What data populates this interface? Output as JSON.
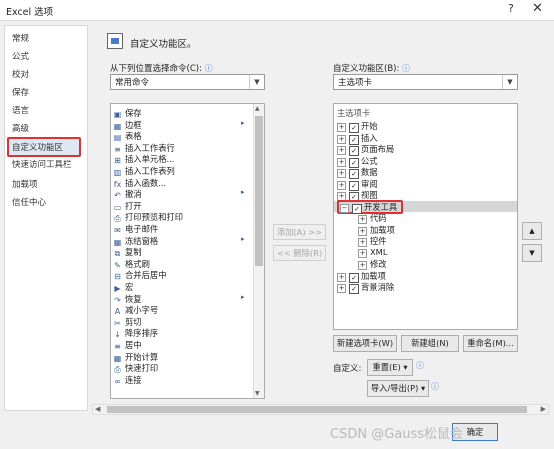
{
  "window": {
    "title": "Excel 选项",
    "help": "?",
    "close": "✕"
  },
  "nav": {
    "items": [
      "常规",
      "公式",
      "校对",
      "保存",
      "语言",
      "高级",
      "自定义功能区",
      "快速访问工具栏",
      "加载项",
      "信任中心"
    ]
  },
  "header": {
    "text": "自定义功能区。"
  },
  "left": {
    "label": "从下列位置选择命令(C):",
    "info": "ⓘ",
    "combo_value": "常用命令",
    "commands": [
      {
        "icon": "save-icon",
        "glyph": "▣",
        "label": "保存",
        "sub": ""
      },
      {
        "icon": "border-icon",
        "glyph": "▦",
        "label": "边框",
        "sub": "▸"
      },
      {
        "icon": "table-icon",
        "glyph": "▤",
        "label": "表格",
        "sub": ""
      },
      {
        "icon": "insert-row-icon",
        "glyph": "≡",
        "label": "插入工作表行",
        "sub": ""
      },
      {
        "icon": "insert-cell-icon",
        "glyph": "⊞",
        "label": "插入单元格...",
        "sub": ""
      },
      {
        "icon": "insert-col-icon",
        "glyph": "▥",
        "label": "插入工作表列",
        "sub": ""
      },
      {
        "icon": "function-icon",
        "glyph": "fx",
        "label": "插入函数...",
        "sub": ""
      },
      {
        "icon": "undo-icon",
        "glyph": "↶",
        "label": "撤消",
        "sub": "▸"
      },
      {
        "icon": "open-icon",
        "glyph": "▭",
        "label": "打开",
        "sub": ""
      },
      {
        "icon": "print-preview-icon",
        "glyph": "⎙",
        "label": "打印预览和打印",
        "sub": ""
      },
      {
        "icon": "mail-icon",
        "glyph": "✉",
        "label": "电子邮件",
        "sub": ""
      },
      {
        "icon": "freeze-icon",
        "glyph": "▦",
        "label": "冻结窗格",
        "sub": "▸"
      },
      {
        "icon": "copy-icon",
        "glyph": "⧉",
        "label": "复制",
        "sub": ""
      },
      {
        "icon": "format-painter-icon",
        "glyph": "✎",
        "label": "格式刷",
        "sub": ""
      },
      {
        "icon": "merge-center-icon",
        "glyph": "⊟",
        "label": "合并后居中",
        "sub": ""
      },
      {
        "icon": "macro-icon",
        "glyph": "▶",
        "label": "宏",
        "sub": ""
      },
      {
        "icon": "redo-icon",
        "glyph": "↷",
        "label": "恢复",
        "sub": "▸"
      },
      {
        "icon": "font-smaller-icon",
        "glyph": "A",
        "label": "减小字号",
        "sub": ""
      },
      {
        "icon": "cut-icon",
        "glyph": "✂",
        "label": "剪切",
        "sub": ""
      },
      {
        "icon": "sort-desc-icon",
        "glyph": "↓",
        "label": "降序排序",
        "sub": ""
      },
      {
        "icon": "center-icon",
        "glyph": "≡",
        "label": "居中",
        "sub": ""
      },
      {
        "icon": "calc-icon",
        "glyph": "▦",
        "label": "开始计算",
        "sub": ""
      },
      {
        "icon": "quick-print-icon",
        "glyph": "⎙",
        "label": "快速打印",
        "sub": ""
      },
      {
        "icon": "link-icon",
        "glyph": "∞",
        "label": "连接",
        "sub": ""
      }
    ]
  },
  "middle": {
    "add": "添加(A) >>",
    "remove": "<< 删除(R)"
  },
  "right": {
    "label": "自定义功能区(B):",
    "info": "ⓘ",
    "combo_value": "主选项卡",
    "tree_header": "主选项卡",
    "tree": [
      {
        "label": "开始",
        "exp": "⊞",
        "check": true,
        "level": 0
      },
      {
        "label": "插入",
        "exp": "⊞",
        "check": true,
        "level": 0
      },
      {
        "label": "页面布局",
        "exp": "⊞",
        "check": true,
        "level": 0
      },
      {
        "label": "公式",
        "exp": "⊞",
        "check": true,
        "level": 0
      },
      {
        "label": "数据",
        "exp": "⊞",
        "check": true,
        "level": 0
      },
      {
        "label": "审阅",
        "exp": "⊞",
        "check": true,
        "level": 0
      },
      {
        "label": "视图",
        "exp": "⊞",
        "check": true,
        "level": 0
      },
      {
        "label": "开发工具",
        "exp": "⊟",
        "check": true,
        "level": 0,
        "highlight": true
      },
      {
        "label": "代码",
        "exp": "⊞",
        "check": null,
        "level": 1
      },
      {
        "label": "加载项",
        "exp": "⊞",
        "check": null,
        "level": 1
      },
      {
        "label": "控件",
        "exp": "⊞",
        "check": null,
        "level": 1
      },
      {
        "label": "XML",
        "exp": "⊞",
        "check": null,
        "level": 1
      },
      {
        "label": "修改",
        "exp": "⊞",
        "check": null,
        "level": 1
      },
      {
        "label": "加载项",
        "exp": "⊞",
        "check": true,
        "level": 0
      },
      {
        "label": "背景消除",
        "exp": "⊞",
        "check": true,
        "level": 0
      }
    ],
    "new_tab": "新建选项卡(W)",
    "new_group": "新建组(N)",
    "rename": "重命名(M)...",
    "customize_label": "自定义:",
    "reset": "重置(E) ▾",
    "import_export": "导入/导出(P) ▾",
    "move_up": "▲",
    "move_down": "▼"
  },
  "footer": {
    "ok": "确定",
    "watermark": "CSDN @Gauss松鼠会"
  }
}
